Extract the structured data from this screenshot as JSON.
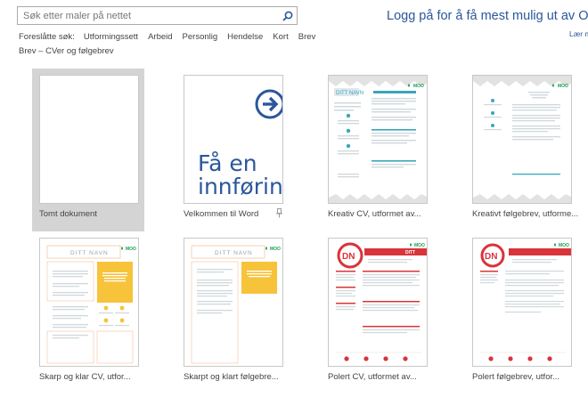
{
  "search": {
    "placeholder": "Søk etter maler på nettet"
  },
  "suggested": {
    "label": "Foreslåtte søk:",
    "items": [
      "Utformingssett",
      "Arbeid",
      "Personlig",
      "Hendelse",
      "Kort",
      "Brev"
    ],
    "line2": "Brev – CVer og følgebrev"
  },
  "signin": {
    "text": "Logg på for å få mest mulig ut av Offi",
    "learn": "Lær m"
  },
  "intro": {
    "line1": "Få en",
    "line2": "innføring"
  },
  "thumb_text": {
    "name": "DITT NAVN",
    "moo": "MOO",
    "dn": "DN",
    "ditt": "DITT"
  },
  "templates": [
    {
      "caption": "Tomt dokument"
    },
    {
      "caption": "Velkommen til Word"
    },
    {
      "caption": "Kreativ CV, utformet av..."
    },
    {
      "caption": "Kreativt følgebrev, utforme..."
    },
    {
      "caption": "Skarp og klar CV, utfor..."
    },
    {
      "caption": "Skarpt og klart følgebre..."
    },
    {
      "caption": "Polert CV, utformet av..."
    },
    {
      "caption": "Polert følgebrev, utfor..."
    }
  ],
  "colors": {
    "accent": "#2b579a",
    "teal": "#3aa6b9",
    "yellow": "#f7c33b",
    "red": "#d9343a",
    "green": "#1f9d55"
  }
}
